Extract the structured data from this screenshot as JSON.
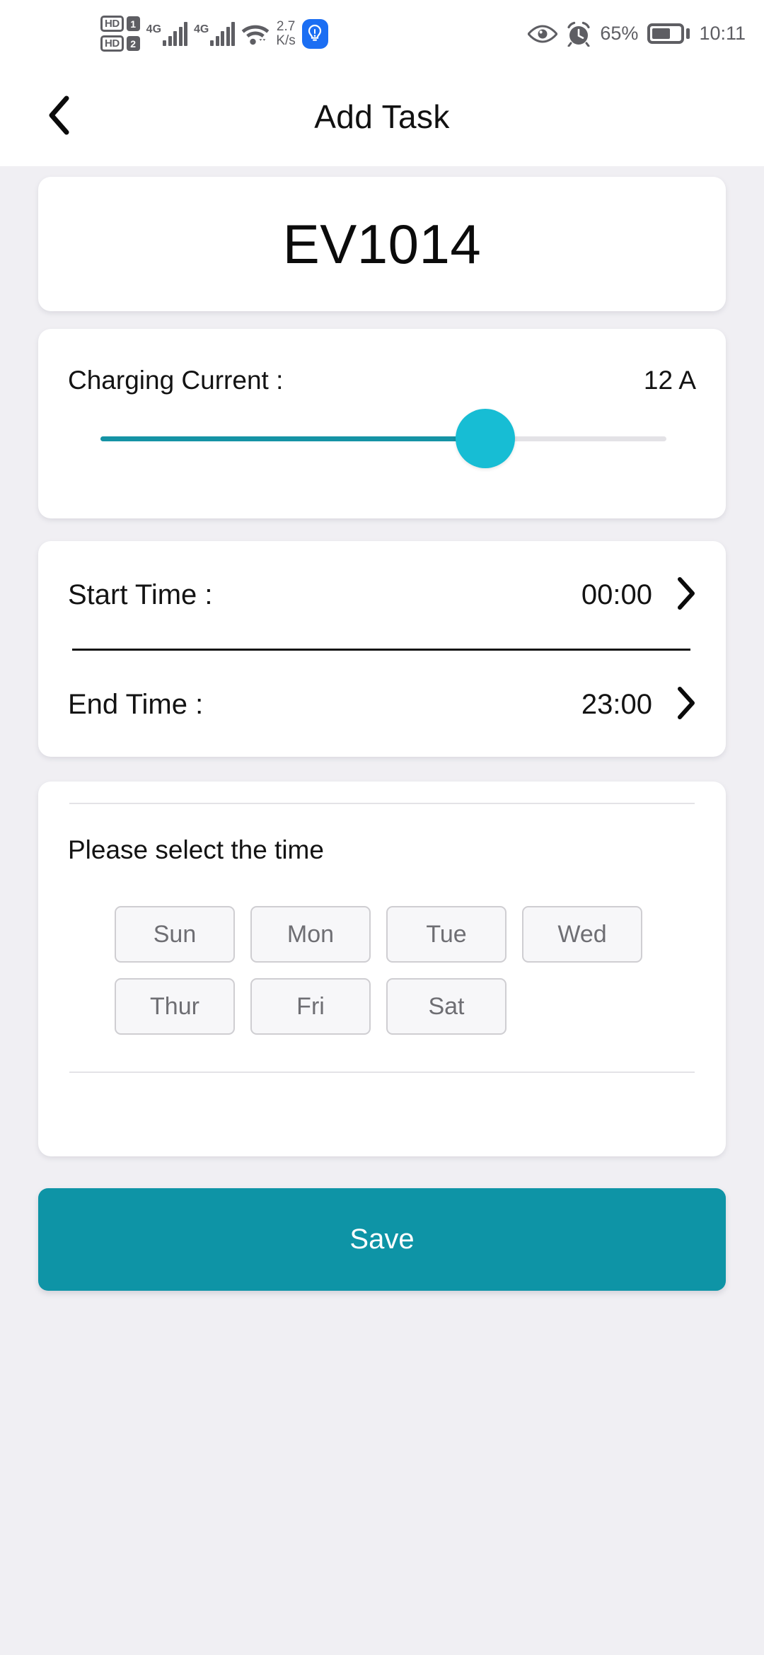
{
  "statusbar": {
    "sim1_hd": "HD",
    "sim1_num": "1",
    "sim2_hd": "HD",
    "sim2_num": "2",
    "net1_type": "4G",
    "net2_type": "4G",
    "net_speed_value": "2.7",
    "net_speed_unit": "K/s",
    "battery_percent": "65%",
    "clock": "10:11",
    "battery_level": 65,
    "icons": {
      "wifi": "wifi-icon",
      "bulb": "lightbulb-icon",
      "eye": "eye-comfort-icon",
      "alarm": "alarm-clock-icon",
      "battery": "battery-icon"
    }
  },
  "header": {
    "title": "Add Task",
    "back_icon": "chevron-left-icon"
  },
  "device": {
    "name": "EV1014"
  },
  "charging_current": {
    "label": "Charging Current :",
    "value": "12 A",
    "slider_percent": 67,
    "track_color": "#1593A5",
    "thumb_color": "#17BDD4",
    "inactive_color": "#E3E2E6"
  },
  "times": {
    "start_label": "Start Time :",
    "start_value": "00:00",
    "end_label": "End Time :",
    "end_value": "23:00",
    "chevron_icon": "chevron-right-icon"
  },
  "days": {
    "title": "Please select the time",
    "chips": [
      {
        "label": "Sun"
      },
      {
        "label": "Mon"
      },
      {
        "label": "Tue"
      },
      {
        "label": "Wed"
      },
      {
        "label": "Thur"
      },
      {
        "label": "Fri"
      },
      {
        "label": "Sat"
      }
    ]
  },
  "footer": {
    "save_label": "Save",
    "save_color": "#0E94A6"
  }
}
